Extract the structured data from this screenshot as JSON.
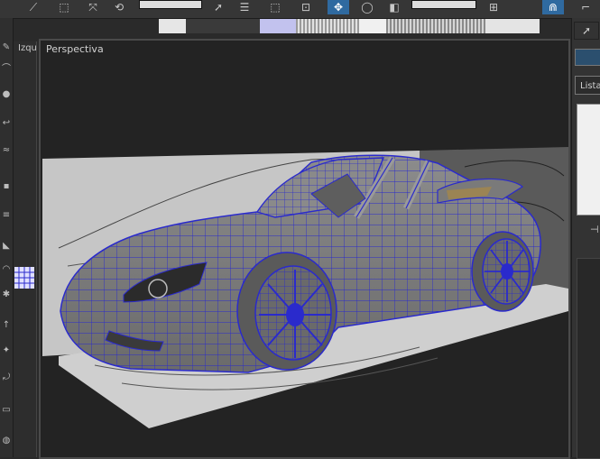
{
  "toolbar": {
    "icons": [
      "lasso-icon",
      "select-object-icon",
      "select-move-icon",
      "dropdown-field",
      "select-arrow-icon",
      "select-by-name-icon",
      "region-select-icon",
      "window-crossing-icon",
      "move-icon",
      "rotate-icon",
      "scale-icon",
      "reference-dropdown",
      "pivot-icon",
      "magnet-icon"
    ],
    "active_icon": "move-icon"
  },
  "left_viewport": {
    "label": "Izqu"
  },
  "main_viewport": {
    "label": "Perspectiva"
  },
  "right_panel": {
    "tab_label": "Lista"
  },
  "colors": {
    "wire": "#2a2acc",
    "panel_bg": "#333333",
    "viewport_bg": "#232323",
    "active_button": "#2f6aa0",
    "plane": "#c8c8c8"
  }
}
